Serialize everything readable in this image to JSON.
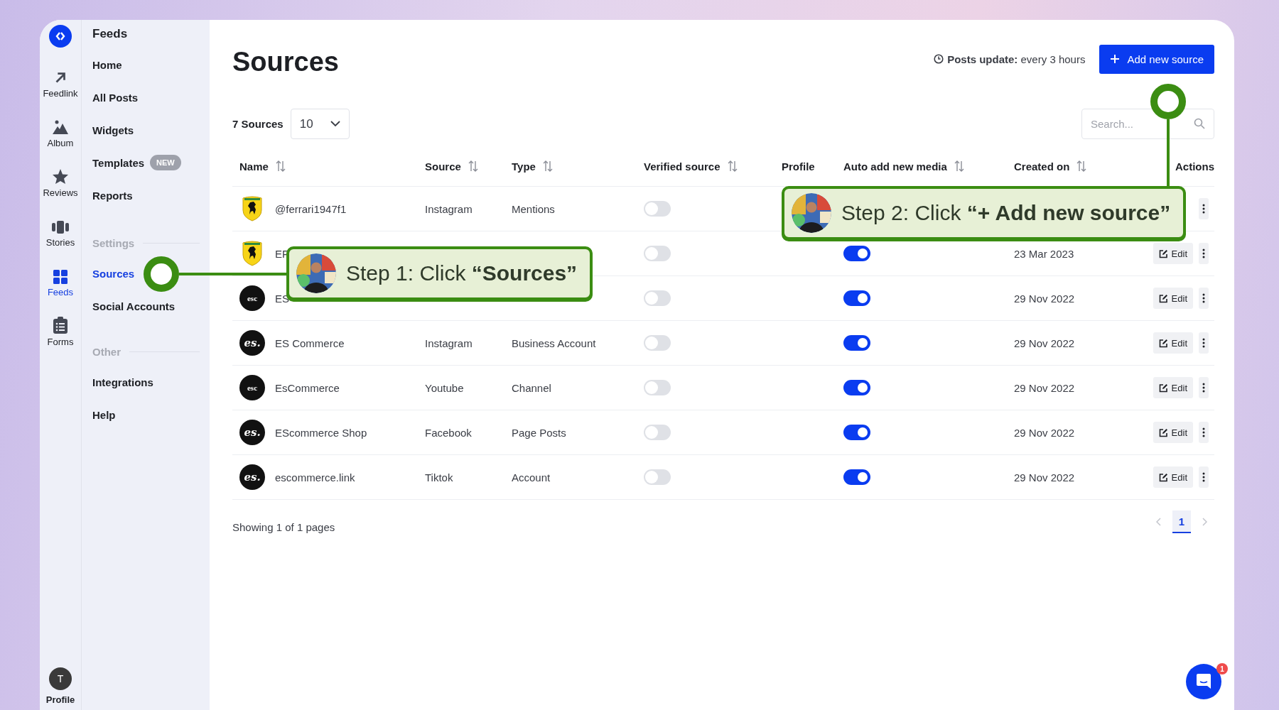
{
  "rail": {
    "items": [
      {
        "label": "Feedlink",
        "selected": false
      },
      {
        "label": "Album",
        "selected": false
      },
      {
        "label": "Reviews",
        "selected": false
      },
      {
        "label": "Stories",
        "selected": false
      },
      {
        "label": "Feeds",
        "selected": true
      },
      {
        "label": "Forms",
        "selected": false
      }
    ],
    "profile": {
      "initial": "T",
      "label": "Profile"
    }
  },
  "sidebar": {
    "title": "Feeds",
    "sections": [
      {
        "items": [
          {
            "label": "Home",
            "selected": false
          },
          {
            "label": "All Posts",
            "selected": false
          },
          {
            "label": "Widgets",
            "selected": false
          },
          {
            "label": "Templates",
            "badge": "NEW",
            "selected": false
          },
          {
            "label": "Reports",
            "selected": false
          }
        ]
      },
      {
        "heading": "Settings",
        "items": [
          {
            "label": "Sources",
            "selected": true
          },
          {
            "label": "Social Accounts",
            "selected": false
          }
        ]
      },
      {
        "heading": "Other",
        "items": [
          {
            "label": "Integrations",
            "selected": false
          },
          {
            "label": "Help",
            "selected": false
          }
        ]
      }
    ]
  },
  "header": {
    "title": "Sources",
    "update_label": "Posts update:",
    "update_value": "every 3 hours",
    "add_button": "Add new source"
  },
  "toolbar": {
    "count": "7 Sources",
    "page_size": "10",
    "search_placeholder": "Search..."
  },
  "table": {
    "columns": [
      {
        "label": "Name",
        "sortable": true
      },
      {
        "label": "Source",
        "sortable": true
      },
      {
        "label": "Type",
        "sortable": true
      },
      {
        "label": "Verified source",
        "sortable": true
      },
      {
        "label": "Profile",
        "sortable": false
      },
      {
        "label": "Auto add new media",
        "sortable": true
      },
      {
        "label": "Created on",
        "sortable": true
      },
      {
        "label": "Actions",
        "sortable": false
      }
    ],
    "rows": [
      {
        "avatar": {
          "kind": "shield"
        },
        "name": "@ferrari1947f1",
        "source": "Instagram",
        "type": "Mentions",
        "verified": false
      },
      {
        "avatar": {
          "kind": "shield"
        },
        "name": "EF",
        "verified": false,
        "auto_add": true,
        "created": "23 Mar 2023",
        "edit": "Edit"
      },
      {
        "avatar": {
          "kind": "text",
          "text": "esc"
        },
        "name": "ES",
        "verified": false,
        "auto_add": true,
        "created": "29 Nov 2022",
        "edit": "Edit"
      },
      {
        "avatar": {
          "kind": "script",
          "text": "es."
        },
        "name": "ES Commerce",
        "source": "Instagram",
        "type": "Business Account",
        "verified": false,
        "auto_add": true,
        "created": "29 Nov 2022",
        "edit": "Edit"
      },
      {
        "avatar": {
          "kind": "text",
          "text": "esc"
        },
        "name": "EsCommerce",
        "source": "Youtube",
        "type": "Channel",
        "verified": false,
        "auto_add": true,
        "created": "29 Nov 2022",
        "edit": "Edit"
      },
      {
        "avatar": {
          "kind": "script",
          "text": "es."
        },
        "name": "EScommerce Shop",
        "source": "Facebook",
        "type": "Page Posts",
        "verified": false,
        "auto_add": true,
        "created": "29 Nov 2022",
        "edit": "Edit"
      },
      {
        "avatar": {
          "kind": "script",
          "text": "es."
        },
        "name": "escommerce.link",
        "source": "Tiktok",
        "type": "Account",
        "verified": false,
        "auto_add": true,
        "created": "29 Nov 2022",
        "edit": "Edit"
      }
    ]
  },
  "footer": {
    "summary": "Showing 1 of 1 pages",
    "pages": [
      {
        "label": "1",
        "selected": true
      }
    ]
  },
  "callouts": [
    {
      "text": "Step 1: Click **“Sources”**"
    },
    {
      "text": "Step 2: Click **“+ Add new source”**"
    }
  ],
  "chat": {
    "badge": "1"
  }
}
